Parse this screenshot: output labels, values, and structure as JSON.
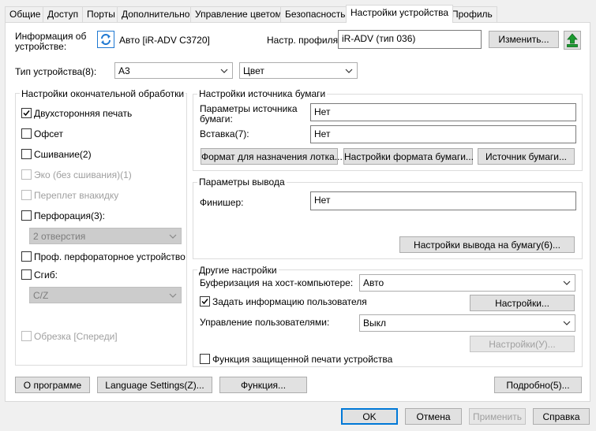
{
  "tabs": [
    "Общие",
    "Доступ",
    "Порты",
    "Дополнительно",
    "Управление цветом",
    "Безопасность",
    "Настройки устройства",
    "Профиль"
  ],
  "device_info": {
    "label": "Информация об устройстве:",
    "name": "Авто [iR-ADV C3720]",
    "profile_label": "Настр. профиля:",
    "profile_value": "iR-ADV (тип 036)",
    "change_button": "Изменить...",
    "type_label": "Тип устройства(8):",
    "type_value": "A3",
    "color_value": "Цвет"
  },
  "finishing": {
    "title": "Настройки окончательной обработки",
    "duplex": "Двухсторонняя печать",
    "offset": "Офсет",
    "stapling": "Сшивание(2)",
    "eco": "Эко (без сшивания)(1)",
    "saddle": "Переплет внакидку",
    "punch": "Перфорация(3):",
    "punch_value": "2 отверстия",
    "pro_punch": "Проф. перфораторное устройство",
    "fold": "Сгиб:",
    "fold_value": "C/Z",
    "trim": "Обрезка [Спереди]"
  },
  "paper_source": {
    "title": "Настройки источника бумаги",
    "options_label": "Параметры источника бумаги:",
    "options_value": "Нет",
    "inserter_label": "Вставка(7):",
    "inserter_value": "Нет",
    "tray_format_button": "Формат для назначения лотка...",
    "paper_format_button": "Настройки формата бумаги...",
    "paper_source_button": "Источник бумаги..."
  },
  "output": {
    "title": "Параметры вывода",
    "finisher_label": "Финишер:",
    "finisher_value": "Нет",
    "output_settings_button": "Настройки вывода на бумагу(6)..."
  },
  "other": {
    "title": "Другие настройки",
    "spool_label": "Буферизация на хост-компьютере:",
    "spool_value": "Авто",
    "user_info": "Задать информацию пользователя",
    "settings_button": "Настройки...",
    "user_mgmt_label": "Управление пользователями:",
    "user_mgmt_value": "Выкл",
    "settings2_button": "Настройки(У)...",
    "secure_print": "Функция защищенной печати устройства"
  },
  "bottom_buttons": {
    "about": "О программе",
    "language": "Language Settings(Z)...",
    "function": "Функция...",
    "details": "Подробно(5)..."
  },
  "dialog_buttons": {
    "ok": "OK",
    "cancel": "Отмена",
    "apply": "Применить",
    "help": "Справка"
  },
  "colors": {
    "accent": "#0078d7",
    "disabled_text": "#a0a0a0",
    "disabled_combo": "#cccccc",
    "printer_icon": "#1e78d2",
    "green_icon": "#1a9a2f"
  }
}
